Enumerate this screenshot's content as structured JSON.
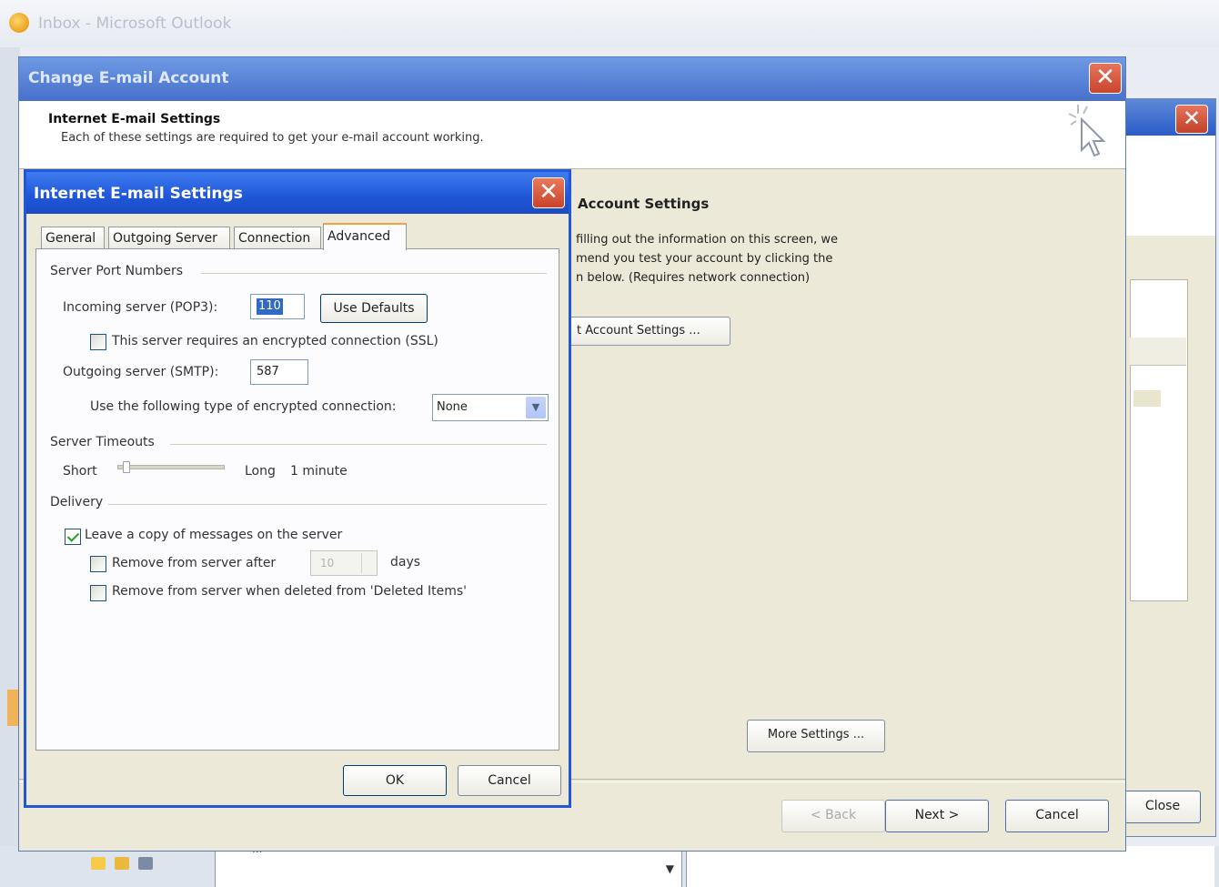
{
  "outlook": {
    "window_title": "Inbox - Microsoft Outlook",
    "pane_text": "...",
    "scroll_arrow": "▼"
  },
  "back_dialog": {
    "close_label": "Close"
  },
  "change_account": {
    "title": "Change E-mail Account",
    "header_title": "Internet E-mail Settings",
    "header_subtitle": "Each of these settings are required to get your e-mail account working.",
    "test_section_title": "Account Settings",
    "test_desc_line1": "filling out the information on this screen, we",
    "test_desc_line2": "mend you test your account by clicking the",
    "test_desc_line3": "n below. (Requires network connection)",
    "test_button_label": "t Account Settings ...",
    "more_settings_label": "More Settings ...",
    "back_label": "< Back",
    "next_label": "Next >",
    "cancel_label": "Cancel"
  },
  "ies": {
    "title": "Internet E-mail Settings",
    "tabs": [
      {
        "label": "General"
      },
      {
        "label": "Outgoing Server"
      },
      {
        "label": "Connection"
      },
      {
        "label": "Advanced"
      }
    ],
    "server_ports": {
      "group_label": "Server Port Numbers",
      "incoming_label": "Incoming server (POP3):",
      "incoming_value": "110",
      "use_defaults_label": "Use Defaults",
      "ssl_label": "This server requires an encrypted connection (SSL)",
      "ssl_checked": false,
      "outgoing_label": "Outgoing server (SMTP):",
      "outgoing_value": "587",
      "encryption_label": "Use the following type of encrypted connection:",
      "encryption_value": "None"
    },
    "timeouts": {
      "group_label": "Server Timeouts",
      "short_label": "Short",
      "long_label": "Long",
      "value_label": "1 minute",
      "slider_level": 0.05
    },
    "delivery": {
      "group_label": "Delivery",
      "leave_copy_label": "Leave a copy of messages on the server",
      "leave_copy_checked": true,
      "remove_after_label": "Remove from server after",
      "remove_after_checked": false,
      "days_value": "10",
      "days_label": "days",
      "remove_deleted_label": "Remove from server when deleted from 'Deleted Items'",
      "remove_deleted_checked": false
    },
    "ok_label": "OK",
    "cancel_label": "Cancel"
  },
  "colors": {
    "xp_title_blue": "#2257d6",
    "dialog_face": "#ece9d8",
    "close_red": "#c8432b",
    "tab_accent": "#f2a23b",
    "check_green": "#21a121"
  }
}
